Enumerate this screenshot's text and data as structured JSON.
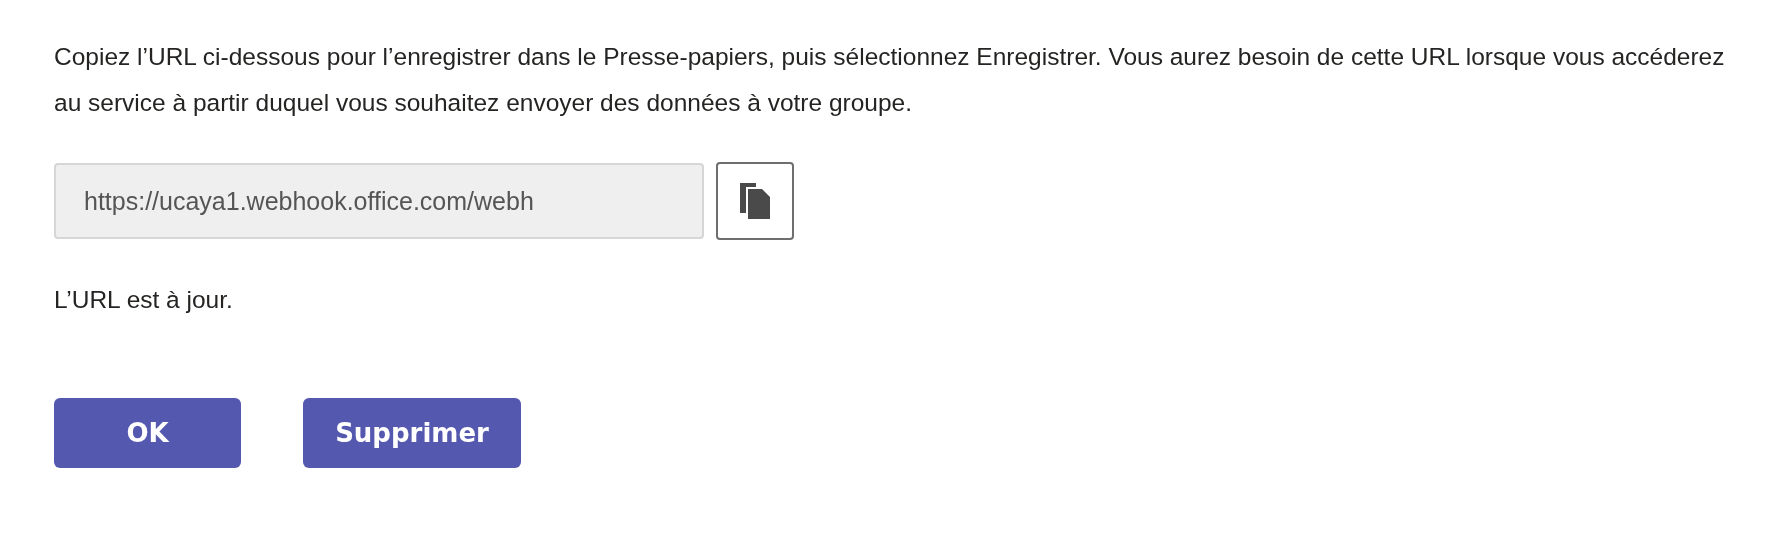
{
  "instructions": "Copiez l’URL ci-dessous pour l’enregistrer dans le Presse-papiers, puis sélectionnez Enregistrer. Vous aurez besoin de cette URL lorsque vous accéderez au service à partir duquel vous souhaitez envoyer des données à votre groupe.",
  "url_field": {
    "value": "https://ucaya1.webhook.office.com/webh"
  },
  "status": "L’URL est à jour.",
  "buttons": [
    {
      "label": "OK"
    },
    {
      "label": "Supprimer"
    }
  ]
}
